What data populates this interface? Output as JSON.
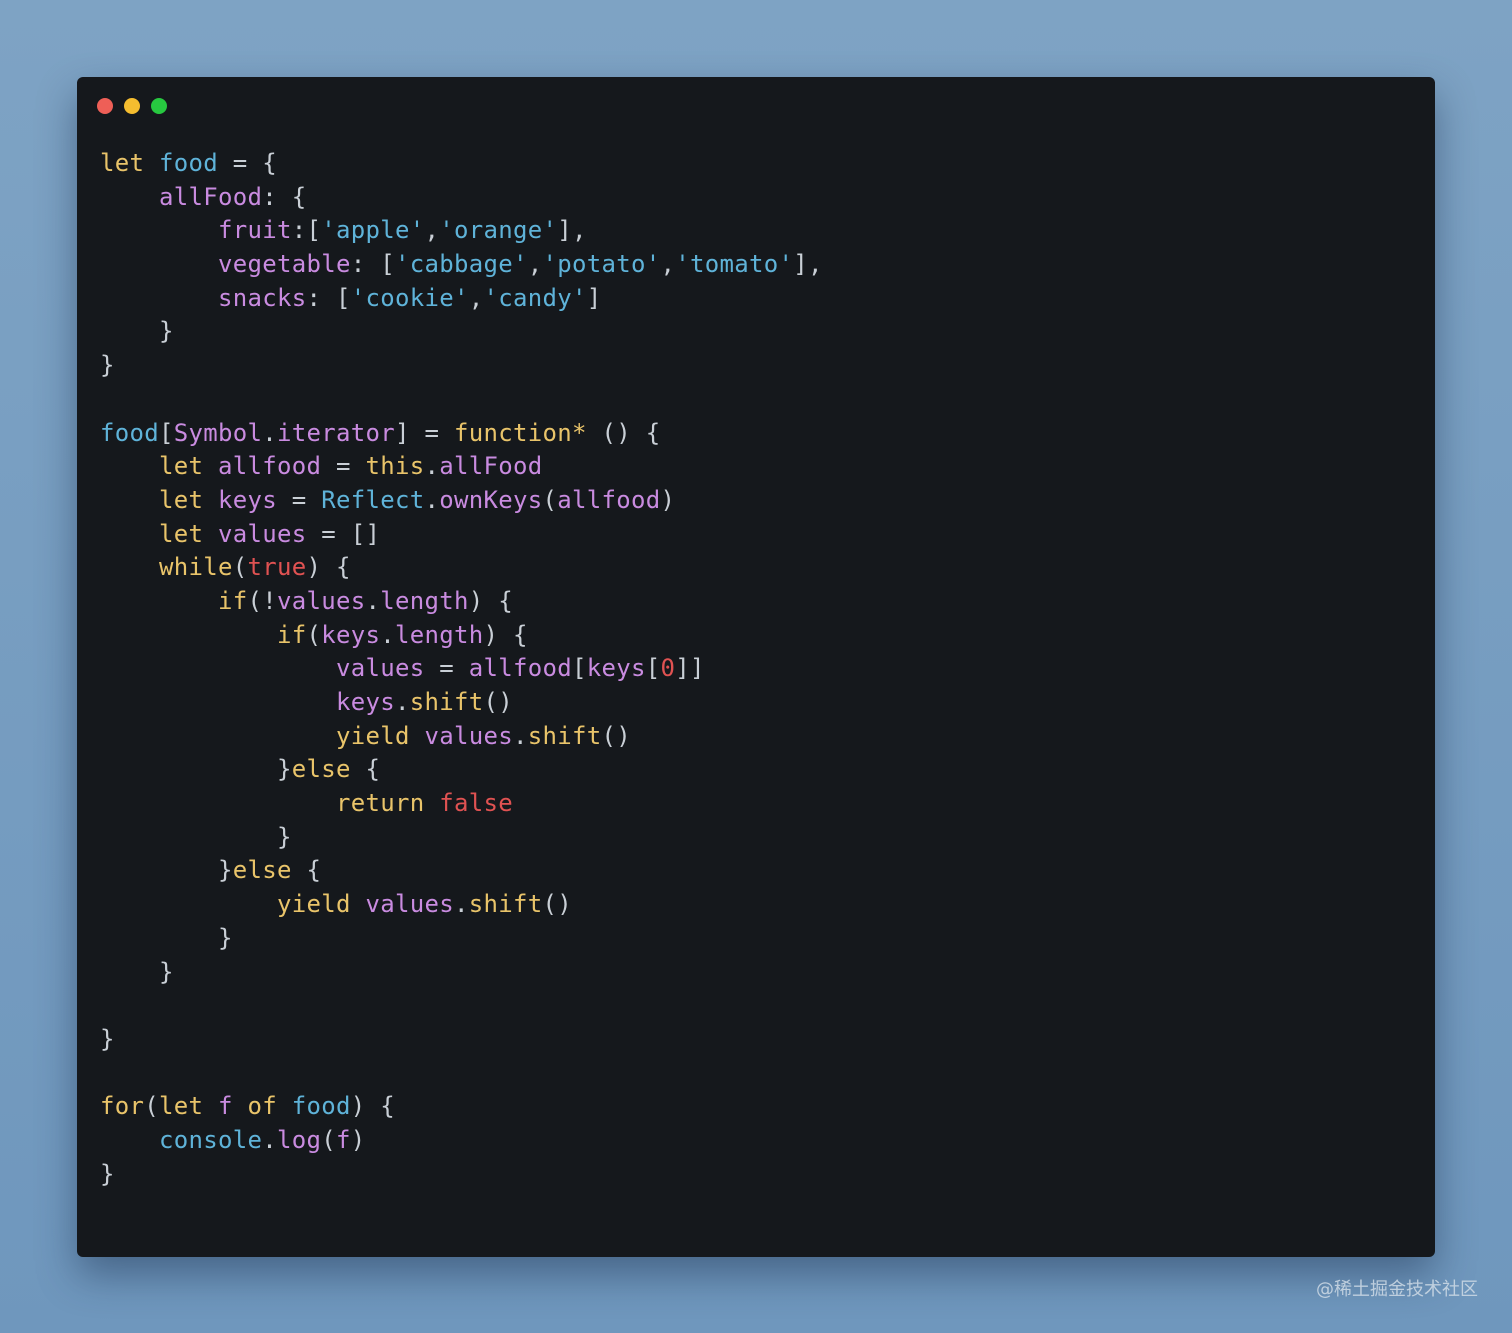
{
  "window": {
    "controls": [
      {
        "name": "close",
        "color": "#ee5f57"
      },
      {
        "name": "minimize",
        "color": "#f5bd2f"
      },
      {
        "name": "zoom",
        "color": "#27c840"
      }
    ]
  },
  "colors": {
    "kw": "#e9c46a",
    "id": "#5fb3d9",
    "prop": "#c98be0",
    "str": "#5fb3d9",
    "punc": "#c9cfd6",
    "num": "#e05252",
    "bool": "#e05252",
    "fn": "#e9c46a",
    "cls": "#5fb3d9"
  },
  "code": [
    [
      [
        "kw",
        "let"
      ],
      [
        "punc",
        " "
      ],
      [
        "id",
        "food"
      ],
      [
        "punc",
        " = {"
      ]
    ],
    [
      [
        "punc",
        "    "
      ],
      [
        "prop",
        "allFood"
      ],
      [
        "punc",
        ": {"
      ]
    ],
    [
      [
        "punc",
        "        "
      ],
      [
        "prop",
        "fruit"
      ],
      [
        "punc",
        ":["
      ],
      [
        "str",
        "'apple'"
      ],
      [
        "punc",
        ","
      ],
      [
        "str",
        "'orange'"
      ],
      [
        "punc",
        "],"
      ]
    ],
    [
      [
        "punc",
        "        "
      ],
      [
        "prop",
        "vegetable"
      ],
      [
        "punc",
        ": ["
      ],
      [
        "str",
        "'cabbage'"
      ],
      [
        "punc",
        ","
      ],
      [
        "str",
        "'potato'"
      ],
      [
        "punc",
        ","
      ],
      [
        "str",
        "'tomato'"
      ],
      [
        "punc",
        "],"
      ]
    ],
    [
      [
        "punc",
        "        "
      ],
      [
        "prop",
        "snacks"
      ],
      [
        "punc",
        ": ["
      ],
      [
        "str",
        "'cookie'"
      ],
      [
        "punc",
        ","
      ],
      [
        "str",
        "'candy'"
      ],
      [
        "punc",
        "]"
      ]
    ],
    [
      [
        "punc",
        "    }"
      ]
    ],
    [
      [
        "punc",
        "}"
      ]
    ],
    [],
    [
      [
        "id",
        "food"
      ],
      [
        "punc",
        "["
      ],
      [
        "prop",
        "Symbol"
      ],
      [
        "punc",
        "."
      ],
      [
        "prop",
        "iterator"
      ],
      [
        "punc",
        "] = "
      ],
      [
        "kw",
        "function*"
      ],
      [
        "punc",
        " () {"
      ]
    ],
    [
      [
        "punc",
        "    "
      ],
      [
        "kw",
        "let"
      ],
      [
        "punc",
        " "
      ],
      [
        "prop",
        "allfood"
      ],
      [
        "punc",
        " = "
      ],
      [
        "kw",
        "this"
      ],
      [
        "punc",
        "."
      ],
      [
        "prop",
        "allFood"
      ]
    ],
    [
      [
        "punc",
        "    "
      ],
      [
        "kw",
        "let"
      ],
      [
        "punc",
        " "
      ],
      [
        "prop",
        "keys"
      ],
      [
        "punc",
        " = "
      ],
      [
        "cls",
        "Reflect"
      ],
      [
        "punc",
        "."
      ],
      [
        "prop",
        "ownKeys"
      ],
      [
        "punc",
        "("
      ],
      [
        "prop",
        "allfood"
      ],
      [
        "punc",
        ")"
      ]
    ],
    [
      [
        "punc",
        "    "
      ],
      [
        "kw",
        "let"
      ],
      [
        "punc",
        " "
      ],
      [
        "prop",
        "values"
      ],
      [
        "punc",
        " = []"
      ]
    ],
    [
      [
        "punc",
        "    "
      ],
      [
        "kw",
        "while"
      ],
      [
        "punc",
        "("
      ],
      [
        "bool",
        "true"
      ],
      [
        "punc",
        ") {"
      ]
    ],
    [
      [
        "punc",
        "        "
      ],
      [
        "kw",
        "if"
      ],
      [
        "punc",
        "(!"
      ],
      [
        "prop",
        "values"
      ],
      [
        "punc",
        "."
      ],
      [
        "prop",
        "length"
      ],
      [
        "punc",
        ") {"
      ]
    ],
    [
      [
        "punc",
        "            "
      ],
      [
        "kw",
        "if"
      ],
      [
        "punc",
        "("
      ],
      [
        "prop",
        "keys"
      ],
      [
        "punc",
        "."
      ],
      [
        "prop",
        "length"
      ],
      [
        "punc",
        ") {"
      ]
    ],
    [
      [
        "punc",
        "                "
      ],
      [
        "prop",
        "values"
      ],
      [
        "punc",
        " = "
      ],
      [
        "prop",
        "allfood"
      ],
      [
        "punc",
        "["
      ],
      [
        "prop",
        "keys"
      ],
      [
        "punc",
        "["
      ],
      [
        "num",
        "0"
      ],
      [
        "punc",
        "]]"
      ]
    ],
    [
      [
        "punc",
        "                "
      ],
      [
        "prop",
        "keys"
      ],
      [
        "punc",
        "."
      ],
      [
        "fn",
        "shift"
      ],
      [
        "punc",
        "()"
      ]
    ],
    [
      [
        "punc",
        "                "
      ],
      [
        "kw",
        "yield"
      ],
      [
        "punc",
        " "
      ],
      [
        "prop",
        "values"
      ],
      [
        "punc",
        "."
      ],
      [
        "fn",
        "shift"
      ],
      [
        "punc",
        "()"
      ]
    ],
    [
      [
        "punc",
        "            }"
      ],
      [
        "kw",
        "else"
      ],
      [
        "punc",
        " {"
      ]
    ],
    [
      [
        "punc",
        "                "
      ],
      [
        "kw",
        "return"
      ],
      [
        "punc",
        " "
      ],
      [
        "bool",
        "false"
      ]
    ],
    [
      [
        "punc",
        "            }"
      ]
    ],
    [
      [
        "punc",
        "        }"
      ],
      [
        "kw",
        "else"
      ],
      [
        "punc",
        " {"
      ]
    ],
    [
      [
        "punc",
        "            "
      ],
      [
        "kw",
        "yield"
      ],
      [
        "punc",
        " "
      ],
      [
        "prop",
        "values"
      ],
      [
        "punc",
        "."
      ],
      [
        "fn",
        "shift"
      ],
      [
        "punc",
        "()"
      ]
    ],
    [
      [
        "punc",
        "        }"
      ]
    ],
    [
      [
        "punc",
        "    }"
      ]
    ],
    [],
    [
      [
        "punc",
        "}"
      ]
    ],
    [],
    [
      [
        "kw",
        "for"
      ],
      [
        "punc",
        "("
      ],
      [
        "kw",
        "let"
      ],
      [
        "punc",
        " "
      ],
      [
        "prop",
        "f"
      ],
      [
        "punc",
        " "
      ],
      [
        "kw",
        "of"
      ],
      [
        "punc",
        " "
      ],
      [
        "id",
        "food"
      ],
      [
        "punc",
        ") {"
      ]
    ],
    [
      [
        "punc",
        "    "
      ],
      [
        "cls",
        "console"
      ],
      [
        "punc",
        "."
      ],
      [
        "prop",
        "log"
      ],
      [
        "punc",
        "("
      ],
      [
        "prop",
        "f"
      ],
      [
        "punc",
        ")"
      ]
    ],
    [
      [
        "punc",
        "}"
      ]
    ]
  ],
  "watermark": "@稀土掘金技术社区"
}
